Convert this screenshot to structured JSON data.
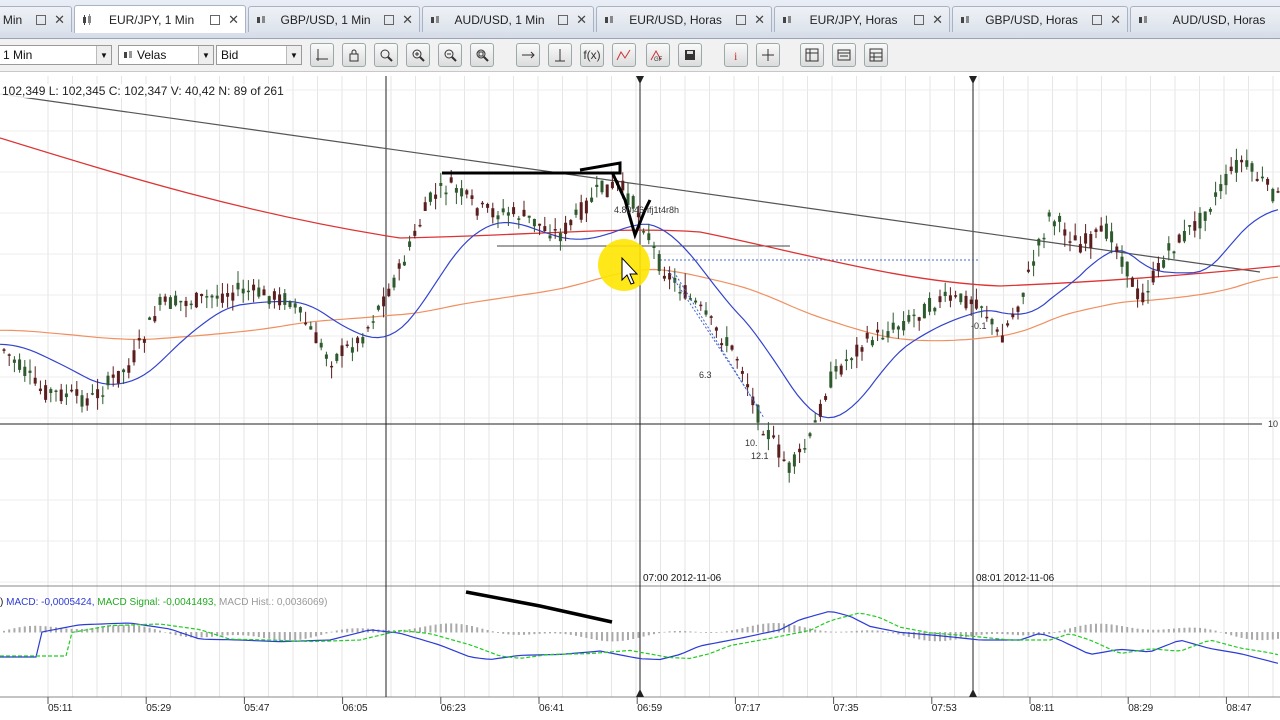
{
  "tabs": [
    {
      "label": "Min",
      "active": false
    },
    {
      "label": "EUR/JPY, 1 Min",
      "active": true
    },
    {
      "label": "GBP/USD, 1 Min",
      "active": false
    },
    {
      "label": "AUD/USD, 1 Min",
      "active": false
    },
    {
      "label": "EUR/USD, Horas",
      "active": false
    },
    {
      "label": "EUR/JPY, Horas",
      "active": false
    },
    {
      "label": "GBP/USD, Horas",
      "active": false
    },
    {
      "label": "AUD/USD, Horas",
      "active": false
    }
  ],
  "toolbar": {
    "period": "1 Min",
    "chart_type": "Velas",
    "price_side": "Bid",
    "fx_label": "f(x)",
    "buttons": [
      "crosshair-icon",
      "lock-icon",
      "zoom-icon",
      "zoom-in-icon",
      "zoom-out-icon",
      "zoom-fit-icon",
      "shift-icon",
      "autoscale-icon",
      "formula-icon",
      "indicator-icon",
      "gf-icon",
      "save-icon",
      "info-icon",
      "cursor-icon",
      "layout-icon",
      "template-icon",
      "table-icon"
    ]
  },
  "ohlc_text": "102,349  L: 102,345  C: 102,347  V: 40,42  N: 89 of 261",
  "macd": {
    "prefix": ")",
    "macd_text": "MACD: -0,0005424,",
    "signal_text": "MACD Signal: -0,0041493,",
    "hist_text": "MACD Hist.: 0,0036069)"
  },
  "colors": {
    "macd_line": "#2b3bd6",
    "signal_line": "#22cc22",
    "ma_red": "#d33",
    "ma_orange": "#f09060",
    "ma_blue": "#3344cc",
    "candle": "#2e5a2e",
    "candle_down": "#5a1e1e",
    "highlight": "#ffe600"
  },
  "vertical_markers": [
    {
      "label": "07:00 2012-11-06"
    },
    {
      "label": "08:01 2012-11-06"
    }
  ],
  "annotations": {
    "note_text": "4.80:46-ifj1t4r8h",
    "label_6_3": "6.3",
    "label_10": "10.",
    "label_12_1": "12.1",
    "label_0_1": "-0.1",
    "right_axis": "10"
  },
  "time_axis": [
    "05:11",
    "05:29",
    "05:47",
    "06:05",
    "06:23",
    "06:41",
    "06:59",
    "07:17",
    "07:35",
    "07:53",
    "08:11",
    "08:29",
    "08:47"
  ]
}
